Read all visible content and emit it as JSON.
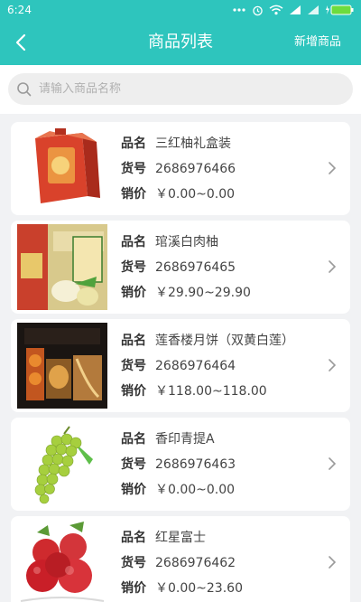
{
  "status_bar": {
    "time": "6:24",
    "notification_icon": "dots-icon",
    "alarm_icon": "alarm-clock-icon",
    "wifi_icon": "wifi-icon",
    "signal_icons": [
      "signal-icon",
      "signal-icon"
    ],
    "battery_icon": "battery-charging-icon",
    "battery_color": "#6ddc3e"
  },
  "nav": {
    "back_icon": "chevron-left-icon",
    "title": "商品列表",
    "action_label": "新增商品",
    "bg_color": "#2ec5bd"
  },
  "search": {
    "icon": "search-icon",
    "placeholder": "请输入商品名称",
    "value": ""
  },
  "labels": {
    "name": "品名",
    "sku": "货号",
    "price": "销价"
  },
  "products": [
    {
      "name": "三红柚礼盒装",
      "sku": "2686976466",
      "price": "￥0.00~0.00",
      "image": "red-gift-box"
    },
    {
      "name": "琯溪白肉柚",
      "sku": "2686976465",
      "price": "￥29.90~29.90",
      "image": "pomelo-box"
    },
    {
      "name": "莲香楼月饼（双黄白莲）",
      "sku": "2686976464",
      "price": "￥118.00~118.00",
      "image": "mooncake-box"
    },
    {
      "name": "香印青提A",
      "sku": "2686976463",
      "price": "￥0.00~0.00",
      "image": "green-grapes"
    },
    {
      "name": "红星富士",
      "sku": "2686976462",
      "price": "￥0.00~23.60",
      "image": "red-apples"
    }
  ],
  "row_chevron_icon": "chevron-right-icon"
}
